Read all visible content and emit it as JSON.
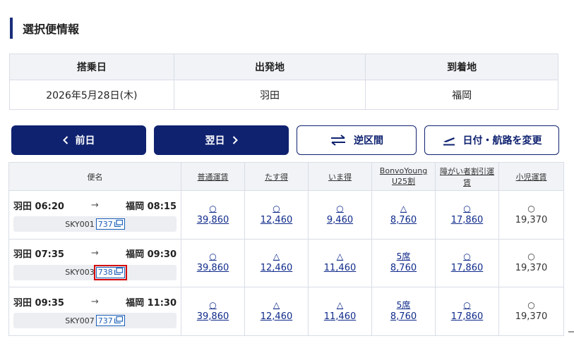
{
  "section_title": "選択便情報",
  "info": {
    "headers": [
      "搭乗日",
      "出発地",
      "到着地"
    ],
    "values": [
      "2026年5月28日(木)",
      "羽田",
      "福岡"
    ]
  },
  "buttons": {
    "prev": "前日",
    "next": "翌日",
    "reverse": "逆区間",
    "change": "日付・航路を変更"
  },
  "flight_table": {
    "headers": [
      "便名",
      "普通運賃",
      "たす得",
      "いま得",
      "BonvoYoung U25割",
      "障がい者割引運賃",
      "小児運賃"
    ],
    "rows": [
      {
        "dep": "羽田 06:20",
        "arrow": "→",
        "arr": "福岡 08:15",
        "flight_no": "SKY001",
        "equipment": "737",
        "fares": [
          {
            "sym": "○",
            "price": "39,860"
          },
          {
            "sym": "○",
            "price": "12,460"
          },
          {
            "sym": "○",
            "price": "9,460"
          },
          {
            "sym": "△",
            "price": "8,760"
          },
          {
            "sym": "○",
            "price": "17,860"
          },
          {
            "sym": "○",
            "price": "19,370"
          }
        ]
      },
      {
        "dep": "羽田 07:35",
        "arrow": "→",
        "arr": "福岡 09:30",
        "flight_no": "SKY003",
        "equipment": "738",
        "fares": [
          {
            "sym": "○",
            "price": "39,860"
          },
          {
            "sym": "△",
            "price": "12,460"
          },
          {
            "sym": "△",
            "price": "11,460"
          },
          {
            "sym": "5席",
            "price": "8,760"
          },
          {
            "sym": "○",
            "price": "17,860"
          },
          {
            "sym": "○",
            "price": "19,370"
          }
        ]
      },
      {
        "dep": "羽田 09:35",
        "arrow": "→",
        "arr": "福岡 11:30",
        "flight_no": "SKY007",
        "equipment": "737",
        "fares": [
          {
            "sym": "○",
            "price": "39,860"
          },
          {
            "sym": "△",
            "price": "12,460"
          },
          {
            "sym": "△",
            "price": "11,460"
          },
          {
            "sym": "5席",
            "price": "8,760"
          },
          {
            "sym": "○",
            "price": "17,860"
          },
          {
            "sym": "○",
            "price": "19,370"
          }
        ]
      }
    ]
  },
  "colors": {
    "navy": "#0f2270",
    "link": "#0f2a8a",
    "highlight": "#d40000",
    "header_bg": "#f1f3f6"
  }
}
